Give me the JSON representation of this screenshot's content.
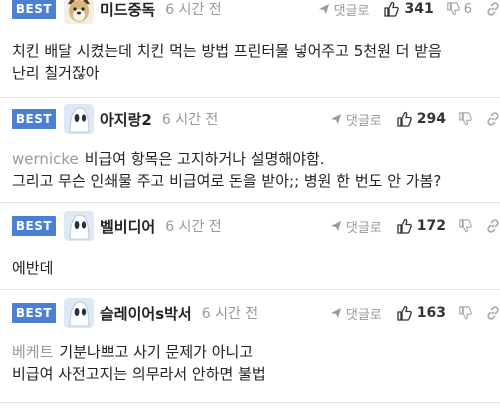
{
  "comments": [
    {
      "badge": "BEST",
      "nickname": "미드중독",
      "time": "6 시간 전",
      "reply_label": "댓글로",
      "likes": "341",
      "dislikes": "6",
      "mention": "",
      "lines": [
        "치킨 배달 시켰는데 치킨 먹는 방법 프린터물 넣어주고 5천원 더 받음",
        "난리 칠거잖아"
      ]
    },
    {
      "badge": "BEST",
      "nickname": "아지랑2",
      "time": "6 시간 전",
      "reply_label": "댓글로",
      "likes": "294",
      "mention": "wernicke",
      "lines": [
        "비급여 항목은 고지하거나 설명해야함.",
        "그리고 무슨 인쇄물 주고 비급여로 돈을 받아;; 병원 한 번도 안 가봄?"
      ]
    },
    {
      "badge": "BEST",
      "nickname": "벨비디어",
      "time": "6 시간 전",
      "reply_label": "댓글로",
      "likes": "172",
      "mention": "",
      "lines": [
        "에반데"
      ]
    },
    {
      "badge": "BEST",
      "nickname": "슬레이어s박서",
      "time": "6 시간 전",
      "reply_label": "댓글로",
      "likes": "163",
      "mention": "베케트",
      "lines": [
        "기분나쁘고 사기 문제가 아니고",
        "비급여 사전고지는 의무라서 안하면 불법"
      ]
    }
  ],
  "colors": {
    "badge": "#4a7fd4",
    "muted": "#999999",
    "text": "#222222"
  },
  "icons": [
    "dog-avatar",
    "ghost-avatar",
    "reply-arrow-icon",
    "thumbs-up-icon",
    "thumbs-down-icon",
    "link-icon"
  ]
}
